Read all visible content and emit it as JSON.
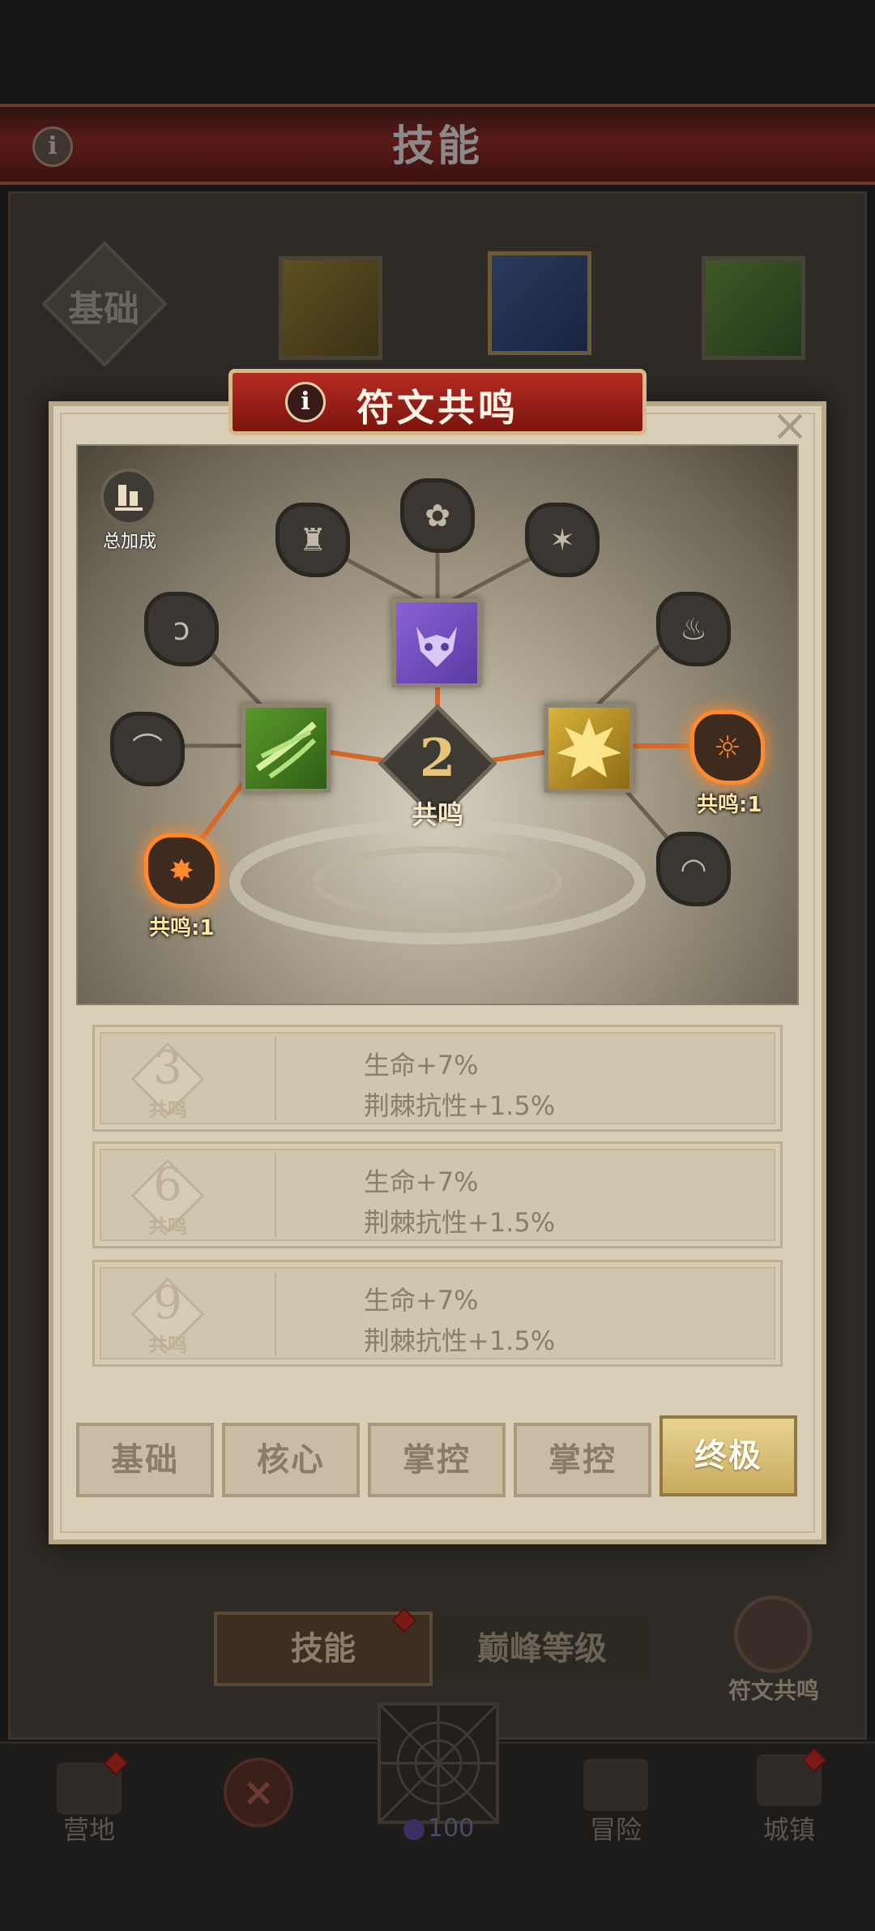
{
  "header": {
    "title": "技能",
    "info_icon": "i"
  },
  "background": {
    "base_label": "基础",
    "skill_icons": [
      "axe-skill-icon",
      "hammer-skill-icon",
      "claw-skill-icon"
    ]
  },
  "popup": {
    "title": "符文共鸣",
    "info_icon": "i",
    "close_icon": "×",
    "bonus_label": "总加成",
    "center": {
      "value": "2",
      "label": "共鸣"
    },
    "nodes": {
      "top_left": "♜",
      "top_mid": "✿",
      "top_right": "✶",
      "left_upper": "ↄ",
      "left_mid": "⌒",
      "left_lit": "✸",
      "right_upper": "♨",
      "right_lit": "☼",
      "right_lower": "◠"
    },
    "lit_labels": {
      "left": "共鸣:1",
      "right": "共鸣:1"
    },
    "levels": [
      {
        "tier": "3",
        "sub": "共鸣",
        "lines": [
          "生命+7%",
          "荆棘抗性+1.5%"
        ]
      },
      {
        "tier": "6",
        "sub": "共鸣",
        "lines": [
          "生命+7%",
          "荆棘抗性+1.5%"
        ]
      },
      {
        "tier": "9",
        "sub": "共鸣",
        "lines": [
          "生命+7%",
          "荆棘抗性+1.5%"
        ]
      }
    ],
    "tabs": [
      {
        "label": "基础",
        "active": false
      },
      {
        "label": "核心",
        "active": false
      },
      {
        "label": "掌控",
        "active": false
      },
      {
        "label": "掌控",
        "active": false
      },
      {
        "label": "终极",
        "active": true
      }
    ]
  },
  "bottom": {
    "skill_tab": "技能",
    "peak_tab": "巅峰等级",
    "rune_label": "符文共鸣",
    "cancel_icon": "×"
  },
  "navbar": {
    "camp": "营地",
    "currency": "100",
    "adventure": "冒险",
    "town": "城镇"
  },
  "colors": {
    "accent_orange": "#ff8a2e",
    "ribbon_red": "#b52b22",
    "active_tab_gold": "#e8d392"
  }
}
